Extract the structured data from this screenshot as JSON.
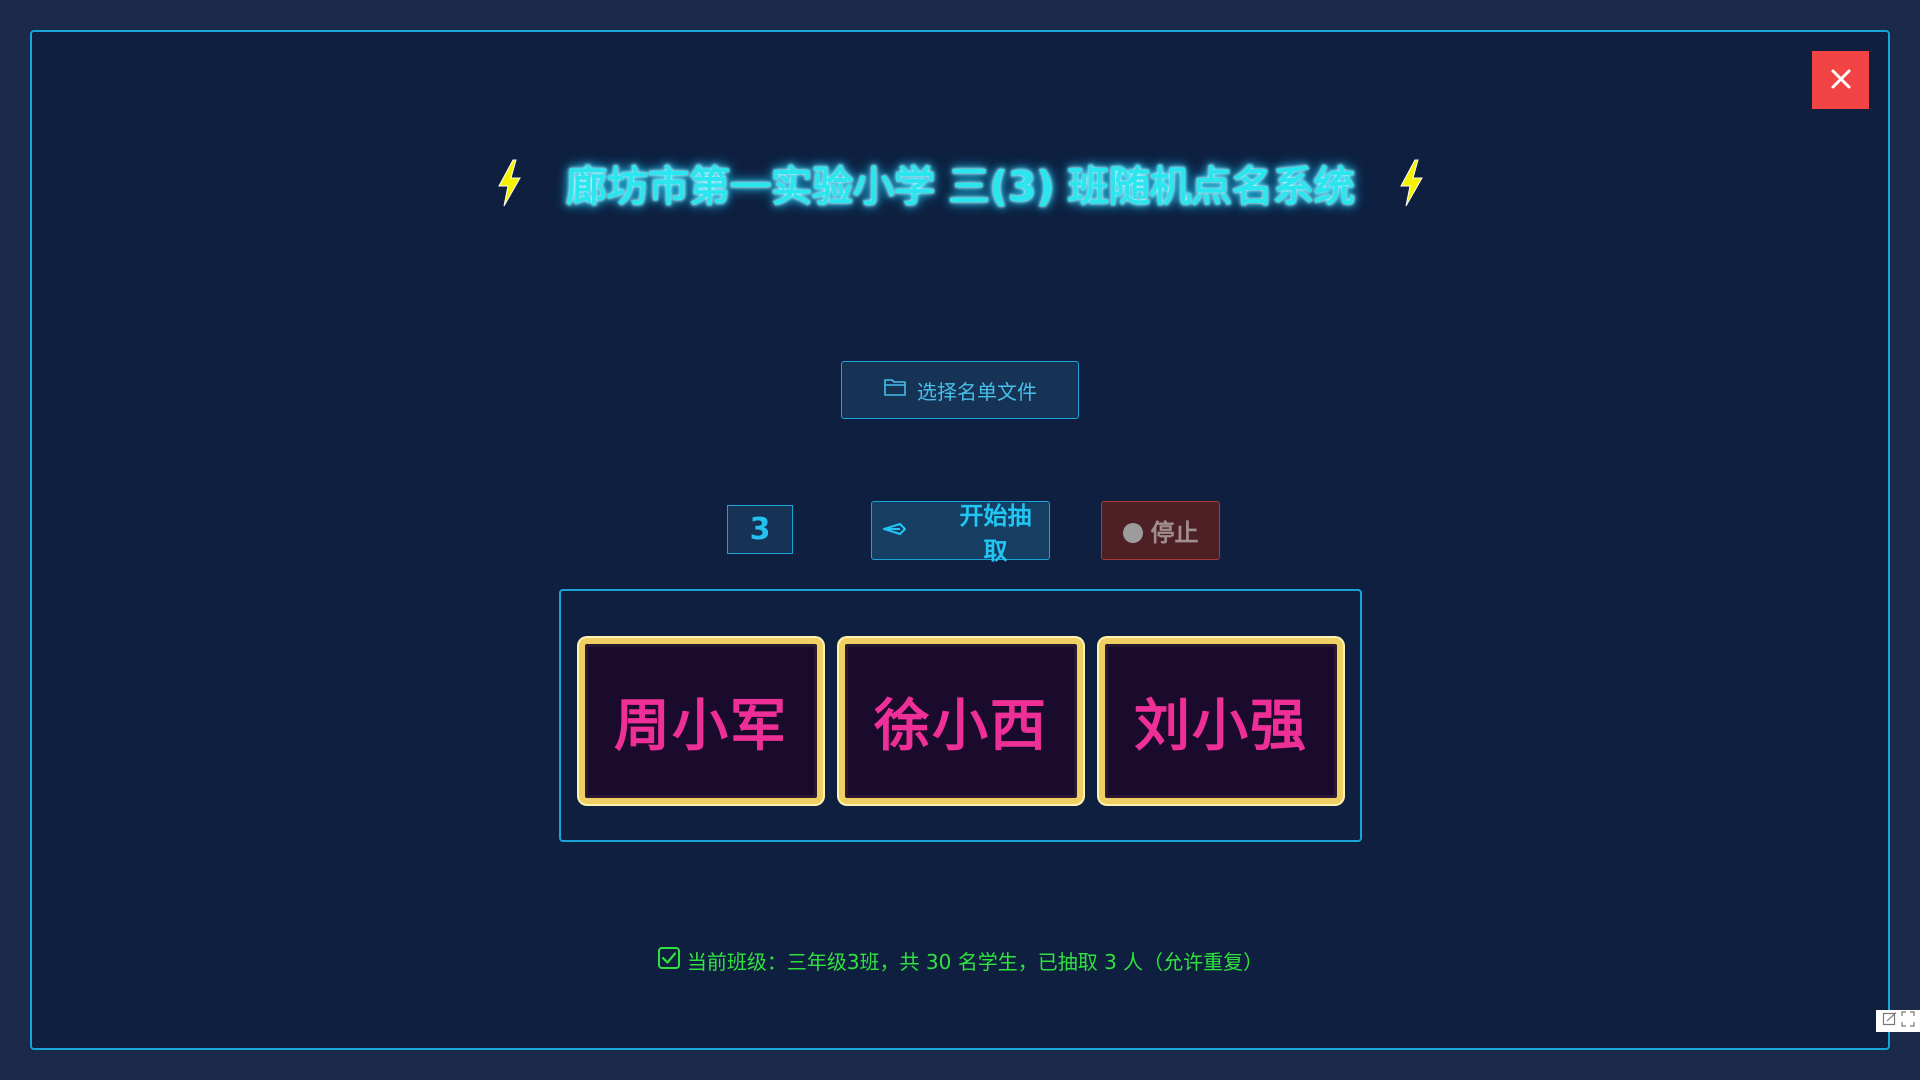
{
  "title": {
    "text": "廊坊市第一实验小学  三(3)  班随机点名系统",
    "left_icon": "lightning-bolt-icon",
    "right_icon": "lightning-bolt-icon"
  },
  "window": {
    "close_icon": "close-icon"
  },
  "file_select": {
    "icon": "folder-icon",
    "label": "选择名单文件"
  },
  "controls": {
    "count": "3",
    "start_icon": "pencil-icon",
    "start_label": "开始抽取",
    "stop_icon": "record-dot-icon",
    "stop_label": "停止"
  },
  "results": {
    "names": [
      "周小军",
      "徐小西",
      "刘小强"
    ]
  },
  "status": {
    "icon": "checkbox-checked-icon",
    "text": "当前班级：三年级3班，共 30 名学生，已抽取 3 人（允许重复）"
  },
  "colors": {
    "background": "#0e1f3f",
    "accent": "#1aa4d8",
    "title": "#2be6ef",
    "name": "#ef2f98",
    "card_border": "#f0cf62",
    "status": "#2fe23f",
    "close": "#f24444",
    "bolt": "#f5f200"
  }
}
